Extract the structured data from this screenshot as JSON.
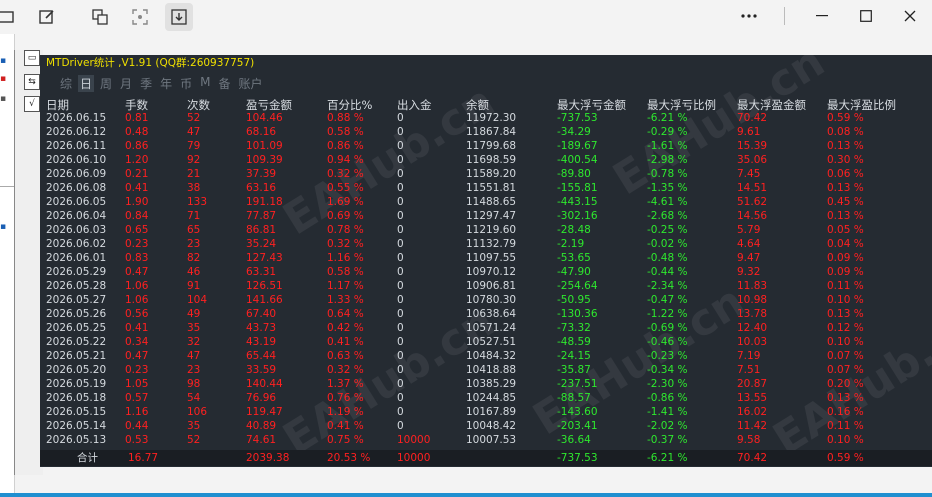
{
  "panel": {
    "title": "MTDriver统计 ,V1.91 (QQ群:260937757)",
    "tabs": [
      "综",
      "日",
      "周",
      "月",
      "季",
      "年",
      "币",
      "M",
      "备",
      "账户"
    ],
    "active_tab": 1
  },
  "columns": [
    "日期",
    "手数",
    "次数",
    "盈亏金额",
    "百分比%",
    "出入金",
    "余额",
    "最大浮亏金额",
    "最大浮亏比例",
    "最大浮盈金额",
    "最大浮盈比例"
  ],
  "rows": [
    [
      "2026.06.15",
      "0.81",
      "52",
      "104.46",
      "0.88 %",
      "0",
      "11972.30",
      "-737.53",
      "-6.21 %",
      "70.42",
      "0.59 %"
    ],
    [
      "2026.06.12",
      "0.48",
      "47",
      "68.16",
      "0.58 %",
      "0",
      "11867.84",
      "-34.29",
      "-0.29 %",
      "9.61",
      "0.08 %"
    ],
    [
      "2026.06.11",
      "0.86",
      "79",
      "101.09",
      "0.86 %",
      "0",
      "11799.68",
      "-189.67",
      "-1.61 %",
      "15.39",
      "0.13 %"
    ],
    [
      "2026.06.10",
      "1.20",
      "92",
      "109.39",
      "0.94 %",
      "0",
      "11698.59",
      "-400.54",
      "-2.98 %",
      "35.06",
      "0.30 %"
    ],
    [
      "2026.06.09",
      "0.21",
      "21",
      "37.39",
      "0.32 %",
      "0",
      "11589.20",
      "-89.80",
      "-0.78 %",
      "7.45",
      "0.06 %"
    ],
    [
      "2026.06.08",
      "0.41",
      "38",
      "63.16",
      "0.55 %",
      "0",
      "11551.81",
      "-155.81",
      "-1.35 %",
      "14.51",
      "0.13 %"
    ],
    [
      "2026.06.05",
      "1.90",
      "133",
      "191.18",
      "1.69 %",
      "0",
      "11488.65",
      "-443.15",
      "-4.61 %",
      "51.62",
      "0.45 %"
    ],
    [
      "2026.06.04",
      "0.84",
      "71",
      "77.87",
      "0.69 %",
      "0",
      "11297.47",
      "-302.16",
      "-2.68 %",
      "14.56",
      "0.13 %"
    ],
    [
      "2026.06.03",
      "0.65",
      "65",
      "86.81",
      "0.78 %",
      "0",
      "11219.60",
      "-28.48",
      "-0.25 %",
      "5.79",
      "0.05 %"
    ],
    [
      "2026.06.02",
      "0.23",
      "23",
      "35.24",
      "0.32 %",
      "0",
      "11132.79",
      "-2.19",
      "-0.02 %",
      "4.64",
      "0.04 %"
    ],
    [
      "2026.06.01",
      "0.83",
      "82",
      "127.43",
      "1.16 %",
      "0",
      "11097.55",
      "-53.65",
      "-0.48 %",
      "9.47",
      "0.09 %"
    ],
    [
      "2026.05.29",
      "0.47",
      "46",
      "63.31",
      "0.58 %",
      "0",
      "10970.12",
      "-47.90",
      "-0.44 %",
      "9.32",
      "0.09 %"
    ],
    [
      "2026.05.28",
      "1.06",
      "91",
      "126.51",
      "1.17 %",
      "0",
      "10906.81",
      "-254.64",
      "-2.34 %",
      "11.83",
      "0.11 %"
    ],
    [
      "2026.05.27",
      "1.06",
      "104",
      "141.66",
      "1.33 %",
      "0",
      "10780.30",
      "-50.95",
      "-0.47 %",
      "10.98",
      "0.10 %"
    ],
    [
      "2026.05.26",
      "0.56",
      "49",
      "67.40",
      "0.64 %",
      "0",
      "10638.64",
      "-130.36",
      "-1.22 %",
      "13.78",
      "0.13 %"
    ],
    [
      "2026.05.25",
      "0.41",
      "35",
      "43.73",
      "0.42 %",
      "0",
      "10571.24",
      "-73.32",
      "-0.69 %",
      "12.40",
      "0.12 %"
    ],
    [
      "2026.05.22",
      "0.34",
      "32",
      "43.19",
      "0.41 %",
      "0",
      "10527.51",
      "-48.59",
      "-0.46 %",
      "10.03",
      "0.10 %"
    ],
    [
      "2026.05.21",
      "0.47",
      "47",
      "65.44",
      "0.63 %",
      "0",
      "10484.32",
      "-24.15",
      "-0.23 %",
      "7.19",
      "0.07 %"
    ],
    [
      "2026.05.20",
      "0.23",
      "23",
      "33.59",
      "0.32 %",
      "0",
      "10418.88",
      "-35.87",
      "-0.34 %",
      "7.51",
      "0.07 %"
    ],
    [
      "2026.05.19",
      "1.05",
      "98",
      "140.44",
      "1.37 %",
      "0",
      "10385.29",
      "-237.51",
      "-2.30 %",
      "20.87",
      "0.20 %"
    ],
    [
      "2026.05.18",
      "0.57",
      "54",
      "76.96",
      "0.76 %",
      "0",
      "10244.85",
      "-88.57",
      "-0.86 %",
      "13.55",
      "0.13 %"
    ],
    [
      "2026.05.15",
      "1.16",
      "106",
      "119.47",
      "1.19 %",
      "0",
      "10167.89",
      "-143.60",
      "-1.41 %",
      "16.02",
      "0.16 %"
    ],
    [
      "2026.05.14",
      "0.44",
      "35",
      "40.89",
      "0.41 %",
      "0",
      "10048.42",
      "-203.41",
      "-2.02 %",
      "11.42",
      "0.11 %"
    ],
    [
      "2026.05.13",
      "0.53",
      "52",
      "74.61",
      "0.75 %",
      "10000",
      "10007.53",
      "-36.64",
      "-0.37 %",
      "9.58",
      "0.10 %"
    ]
  ],
  "totals": {
    "label": "合计",
    "lots": "16.77",
    "profit": "2039.38",
    "percent": "20.53 %",
    "deposit": "10000",
    "max_float_loss": "-737.53",
    "max_float_loss_pct": "-6.21 %",
    "max_float_profit": "70.42",
    "max_float_profit_pct": "0.59 %"
  },
  "colors": {
    "panel_bg": "#252b32",
    "positive": "#ff2020",
    "negative": "#2ee82e",
    "title": "#f0e000"
  },
  "watermark": "EAHub.cn",
  "toolbar_icons": [
    "window-icon",
    "edit-icon",
    "translate-icon",
    "focus-icon",
    "download-icon",
    "more-icon",
    "minimize-icon",
    "maximize-icon",
    "close-icon"
  ]
}
